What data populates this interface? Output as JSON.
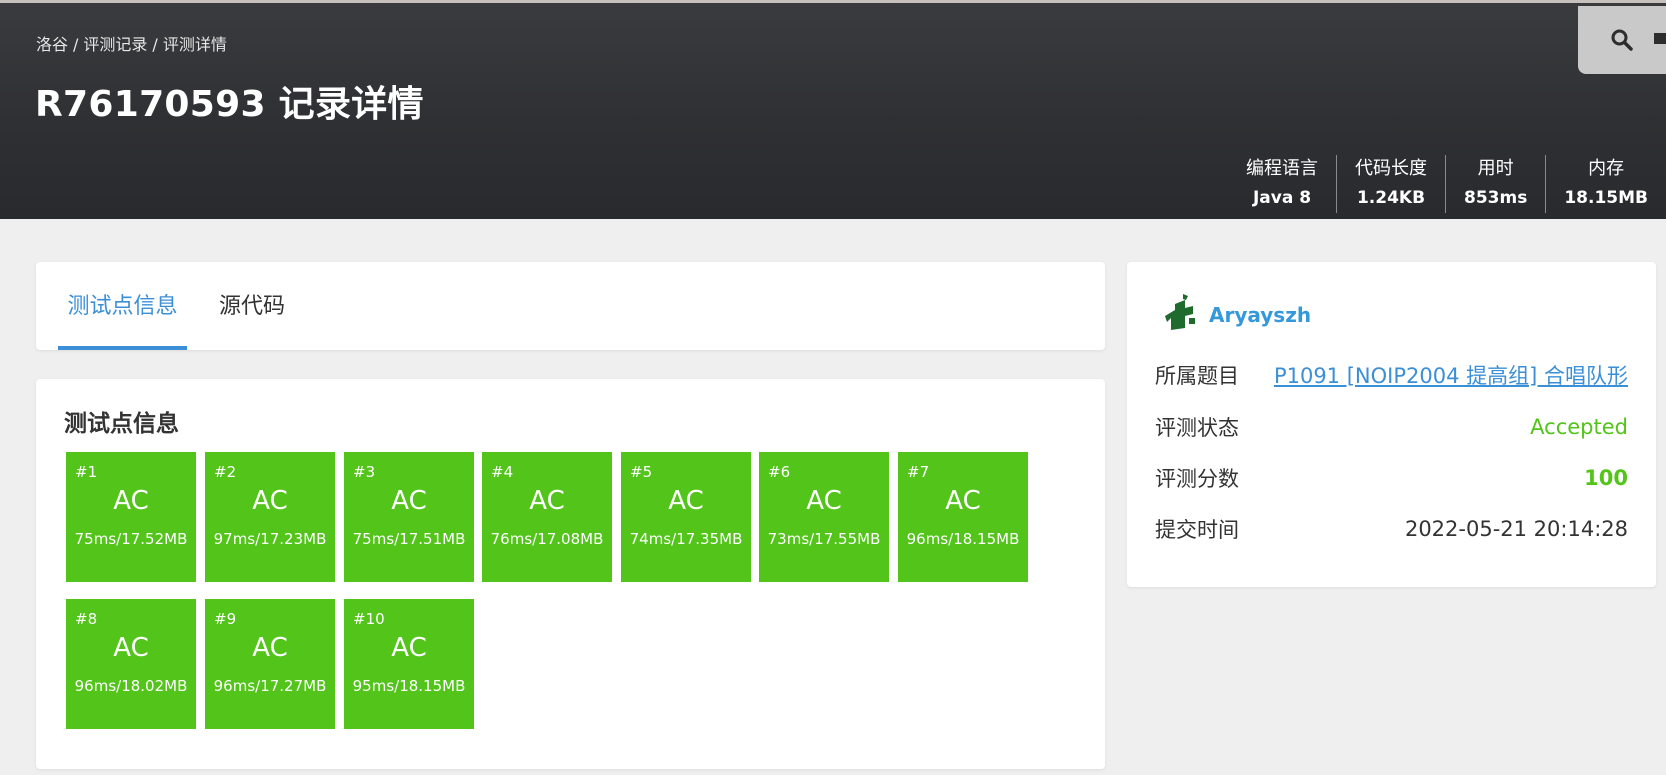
{
  "breadcrumb": [
    "洛谷",
    "评测记录",
    "评测详情"
  ],
  "page_title": "R76170593 记录详情",
  "stats": [
    {
      "label": "编程语言",
      "value": "Java 8"
    },
    {
      "label": "代码长度",
      "value": "1.24KB"
    },
    {
      "label": "用时",
      "value": "853ms"
    },
    {
      "label": "内存",
      "value": "18.15MB"
    }
  ],
  "tabs": {
    "active": "测试点信息",
    "other": "源代码"
  },
  "testcases": {
    "title": "测试点信息",
    "color": "#52c41a",
    "items": [
      {
        "num": "#1",
        "status": "AC",
        "detail": "75ms/17.52MB"
      },
      {
        "num": "#2",
        "status": "AC",
        "detail": "97ms/17.23MB"
      },
      {
        "num": "#3",
        "status": "AC",
        "detail": "75ms/17.51MB"
      },
      {
        "num": "#4",
        "status": "AC",
        "detail": "76ms/17.08MB"
      },
      {
        "num": "#5",
        "status": "AC",
        "detail": "74ms/17.35MB"
      },
      {
        "num": "#6",
        "status": "AC",
        "detail": "73ms/17.55MB"
      },
      {
        "num": "#7",
        "status": "AC",
        "detail": "96ms/18.15MB"
      },
      {
        "num": "#8",
        "status": "AC",
        "detail": "96ms/18.02MB"
      },
      {
        "num": "#9",
        "status": "AC",
        "detail": "96ms/17.27MB"
      },
      {
        "num": "#10",
        "status": "AC",
        "detail": "95ms/18.15MB"
      }
    ]
  },
  "info": {
    "user": {
      "name": "Aryayszh",
      "avatar_icon": "user-avatar-icon",
      "name_color": "#3498db"
    },
    "problem": {
      "label": "所属题目",
      "value": "P1091 [NOIP2004 提高组] 合唱队形"
    },
    "status": {
      "label": "评测状态",
      "value": "Accepted"
    },
    "score": {
      "label": "评测分数",
      "value": "100"
    },
    "submit_time": {
      "label": "提交时间",
      "value": "2022-05-21 20:14:28"
    }
  },
  "icons": {
    "search": "search-icon",
    "mail": "mail-icon"
  },
  "colors": {
    "accent": "#3b8fd6",
    "success": "#52c41a",
    "header_bg": "#2f3033"
  }
}
